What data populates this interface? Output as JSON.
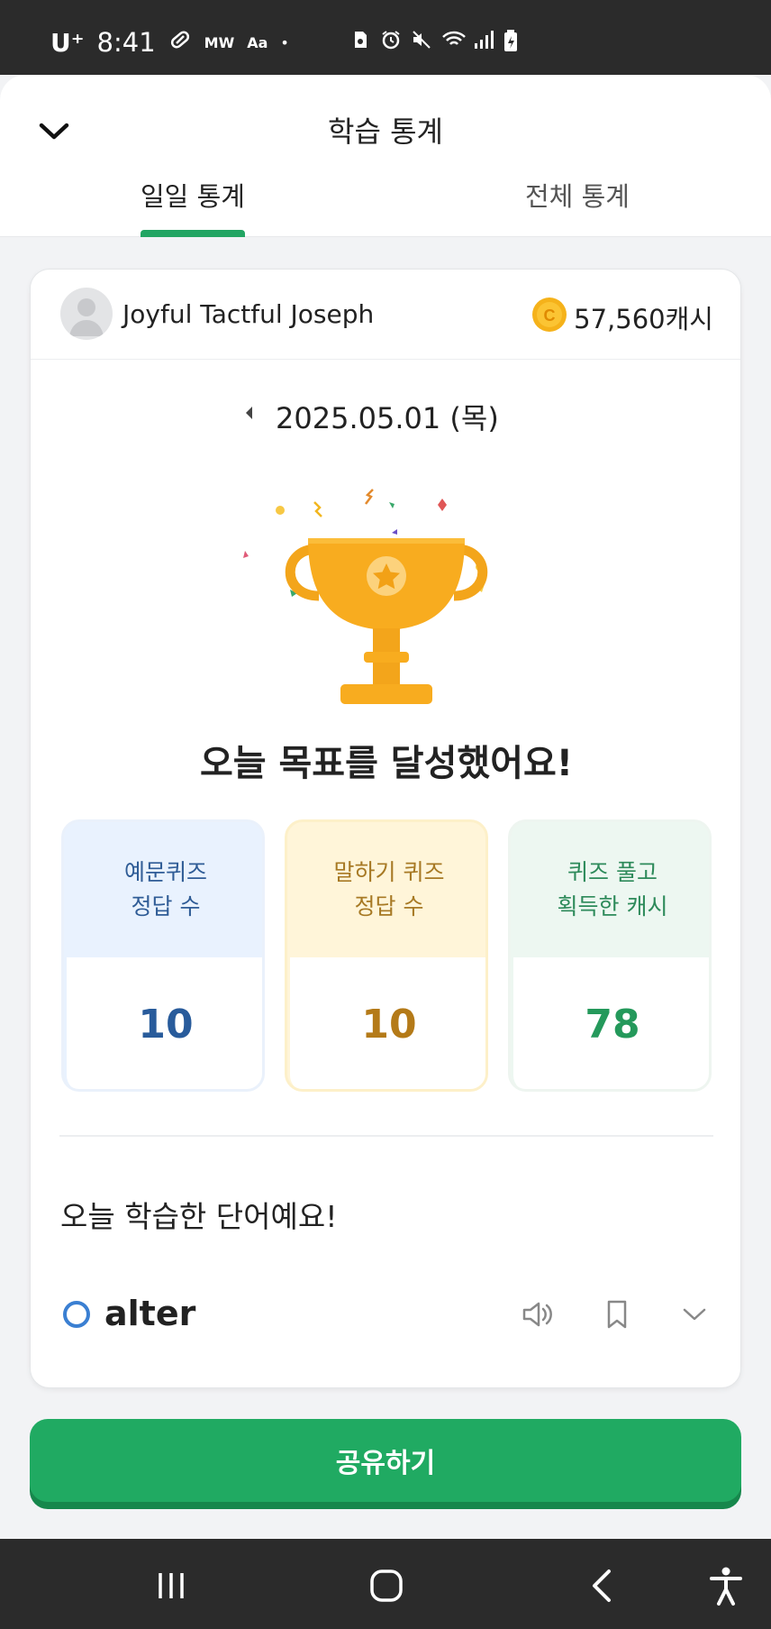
{
  "status_bar": {
    "carrier": "U⁺",
    "time": "8:41",
    "indicator_1": "MW",
    "indicator_2": "Aa",
    "dot": "•",
    "icons": [
      "sd-card-icon",
      "alarm-icon",
      "mute-icon",
      "wifi-icon",
      "signal-icon",
      "battery-icon"
    ]
  },
  "header": {
    "title": "학습 통계",
    "tabs": [
      {
        "label": "일일 통계",
        "selected": true
      },
      {
        "label": "전체 통계",
        "selected": false
      }
    ],
    "accent_color": "#22a563"
  },
  "profile": {
    "name": "Joyful Tactful Joseph",
    "coin_symbol": "C",
    "cash": "57,560캐시"
  },
  "date": {
    "text": "2025.05.01 (목)"
  },
  "goal": {
    "message": "오늘 목표를 달성했어요!"
  },
  "stats": [
    {
      "label_line1": "예문퀴즈",
      "label_line2": "정답 수",
      "value": "10"
    },
    {
      "label_line1": "말하기 퀴즈",
      "label_line2": "정답 수",
      "value": "10"
    },
    {
      "label_line1": "퀴즈 풀고",
      "label_line2": "획득한 캐시",
      "value": "78"
    }
  ],
  "words": {
    "heading": "오늘 학습한 단어예요!",
    "items": [
      {
        "word": "alter"
      }
    ]
  },
  "share_button": {
    "label": "공유하기"
  },
  "nav_bar": {
    "icons": [
      "recent-apps-icon",
      "home-icon",
      "back-icon",
      "accessibility-icon"
    ]
  }
}
